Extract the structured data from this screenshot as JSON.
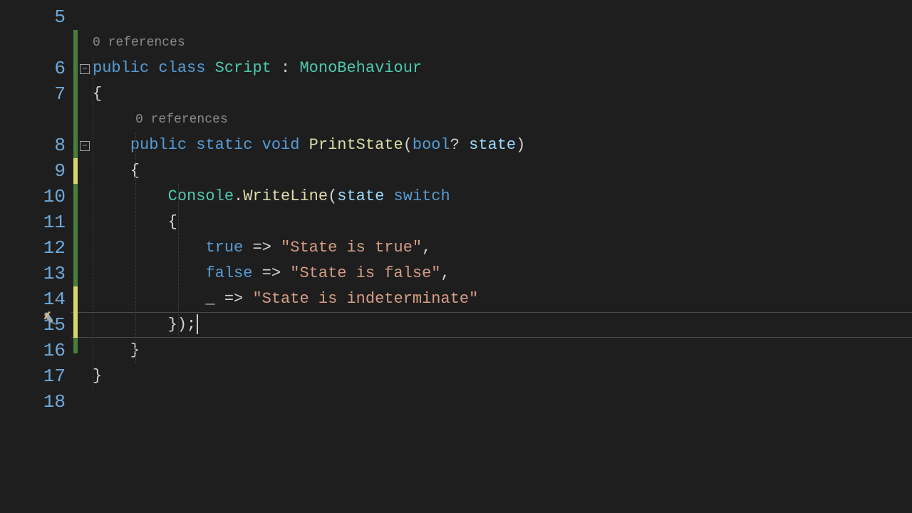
{
  "gutter": {
    "start": 5,
    "end": 18
  },
  "codelens": {
    "class": "0 references",
    "method": "0 references"
  },
  "code": {
    "l6": {
      "kw1": "public",
      "kw2": "class",
      "name": "Script",
      "colon": " : ",
      "base": "MonoBehaviour"
    },
    "l7": "{",
    "l8": {
      "kw1": "public",
      "kw2": "static",
      "kw3": "void",
      "name": "PrintState",
      "lp": "(",
      "ptype": "bool",
      "q": "?",
      "sp": " ",
      "pname": "state",
      "rp": ")"
    },
    "l9": "    {",
    "l10": {
      "pre": "        ",
      "cls": "Console",
      "dot": ".",
      "m": "WriteLine",
      "lp": "(",
      "arg": "state",
      "sp": " ",
      "sw": "switch"
    },
    "l11": "        {",
    "l12": {
      "pre": "            ",
      "kw": "true",
      "arrow": " => ",
      "str": "\"State is true\"",
      "comma": ","
    },
    "l13": {
      "pre": "            ",
      "kw": "false",
      "arrow": " => ",
      "str": "\"State is false\"",
      "comma": ","
    },
    "l14": {
      "pre": "            ",
      "under": "_",
      "arrow": " => ",
      "str": "\"State is indeterminate\""
    },
    "l15": "        });",
    "l16": "    }",
    "l17": "}"
  },
  "highlight_line_index": 11,
  "change_bars": {
    "yellow_ranges": [
      [
        6,
        6
      ],
      [
        11,
        12
      ]
    ]
  }
}
